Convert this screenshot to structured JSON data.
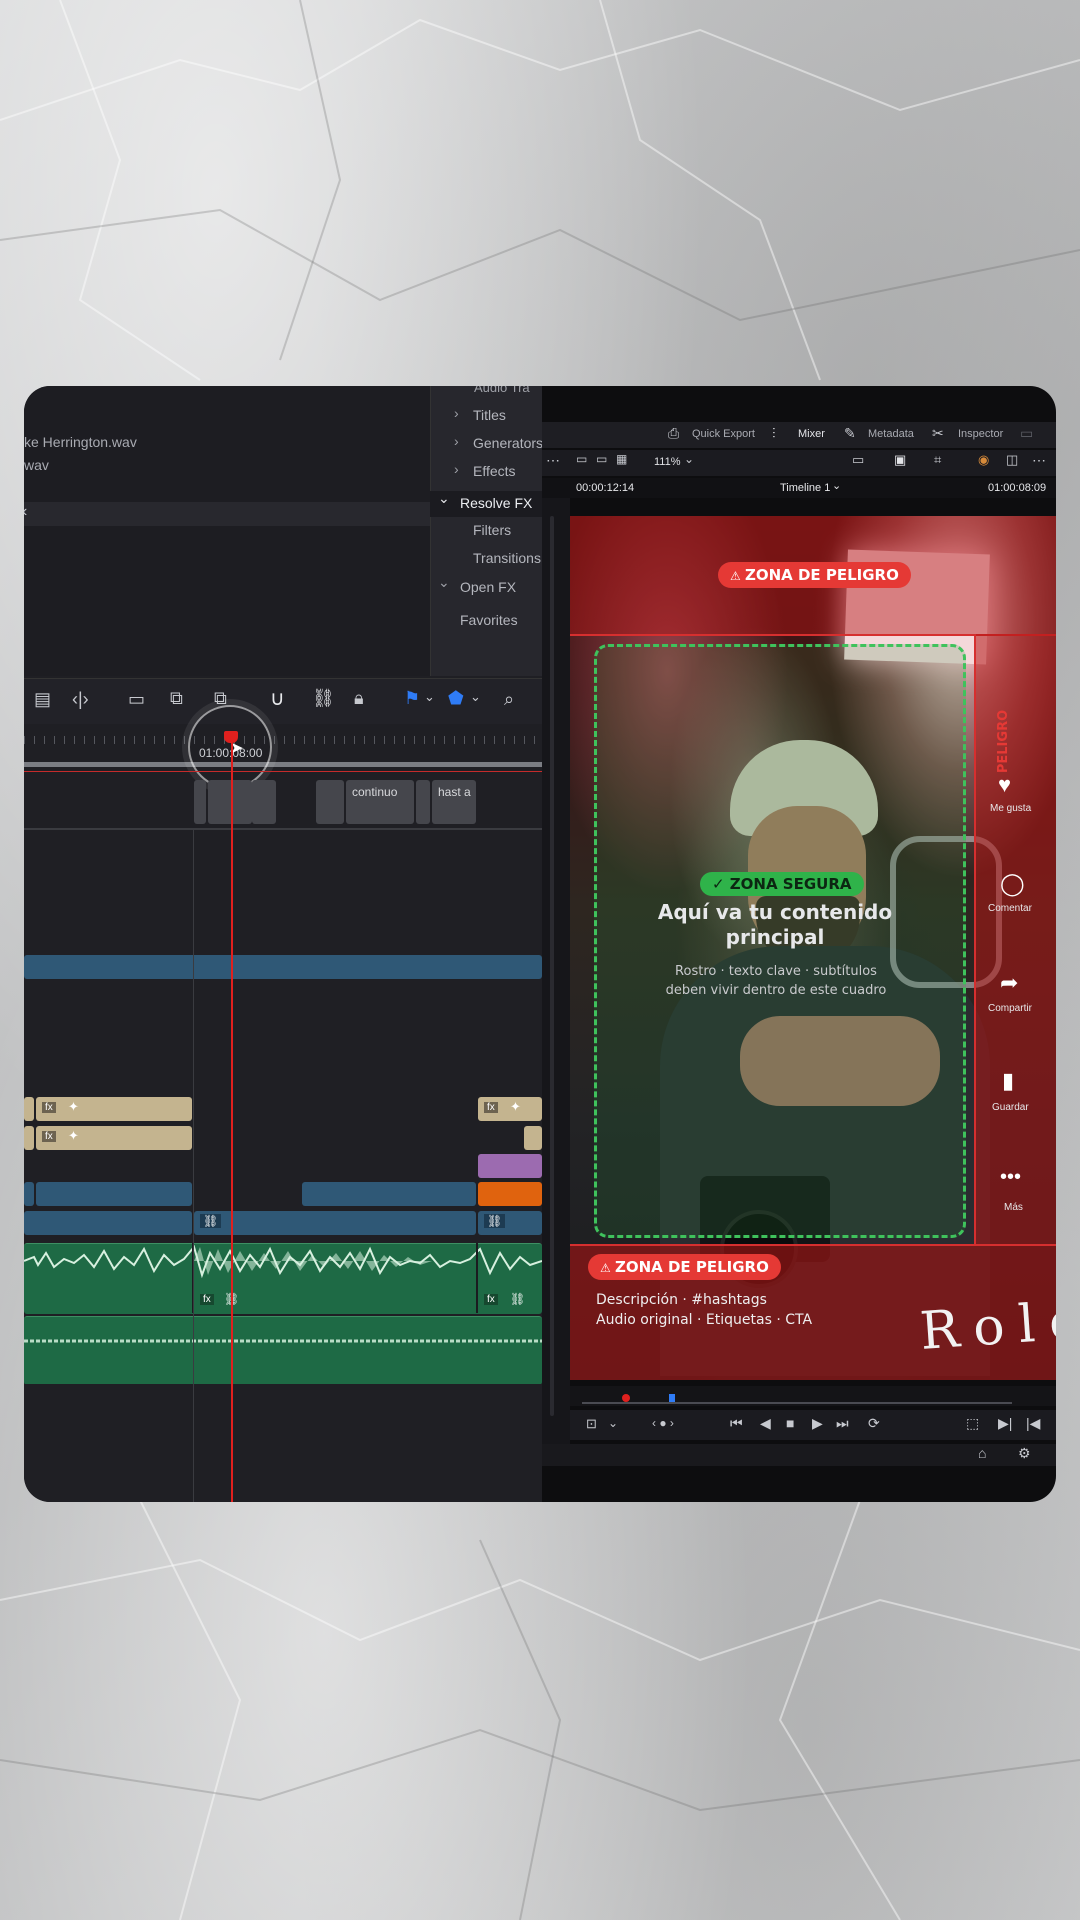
{
  "media_pool": {
    "files": [
      "ke Herrington.wav",
      "wav"
    ]
  },
  "effects_tree": {
    "items": [
      {
        "label": "Audio Tra",
        "chevron": "",
        "indent": 2
      },
      {
        "label": "Titles",
        "chevron": "›",
        "indent": 1
      },
      {
        "label": "Generators",
        "chevron": "›",
        "indent": 1
      },
      {
        "label": "Effects",
        "chevron": "›",
        "indent": 1
      },
      {
        "label": "Resolve FX",
        "chevron": "⌄",
        "indent": 0,
        "active": true
      },
      {
        "label": "Filters",
        "chevron": "",
        "indent": 2
      },
      {
        "label": "Transitions",
        "chevron": "",
        "indent": 2
      },
      {
        "label": "Open FX",
        "chevron": "⌄",
        "indent": 0
      },
      {
        "label": "Favorites",
        "chevron": "",
        "indent": 0
      }
    ]
  },
  "timeline": {
    "playhead_timecode": "01:00:08:00",
    "subtitle_clips": [
      "continuo",
      "hast a"
    ],
    "fx_badge": "fx",
    "cursor_icon": "cursor-icon",
    "playhead_color": "#e0201e"
  },
  "toolbar_right": {
    "quick_export": "Quick Export",
    "mixer": "Mixer",
    "metadata": "Metadata",
    "inspector": "Inspector"
  },
  "viewer": {
    "zoom": "111%",
    "timecode_left": "00:00:12:14",
    "timeline_name": "Timeline 1",
    "timecode_right": "01:00:08:09"
  },
  "overlay": {
    "danger_top": "ZONA DE PELIGRO",
    "safe_label": "ZONA SEGURA",
    "safe_title": "Aquí va tu contenido principal",
    "safe_sub": "Rostro · texto clave · subtítulos deben vivir dentro de este cuadro",
    "side_danger": "PELIGRO",
    "danger_bottom": "ZONA DE PELIGRO",
    "bottom_line1": "Descripción · #hashtags",
    "bottom_line2": "Audio original · Etiquetas · CTA",
    "signature": "Rolo",
    "danger_color": "#e53935",
    "safe_color": "#2fb34a"
  },
  "social_rail": [
    {
      "label": "Me gusta",
      "icon": "heart-icon"
    },
    {
      "label": "Comentar",
      "icon": "comment-icon"
    },
    {
      "label": "Compartir",
      "icon": "share-icon"
    },
    {
      "label": "Guardar",
      "icon": "bookmark-icon"
    },
    {
      "label": "Más",
      "icon": "more-icon"
    }
  ]
}
